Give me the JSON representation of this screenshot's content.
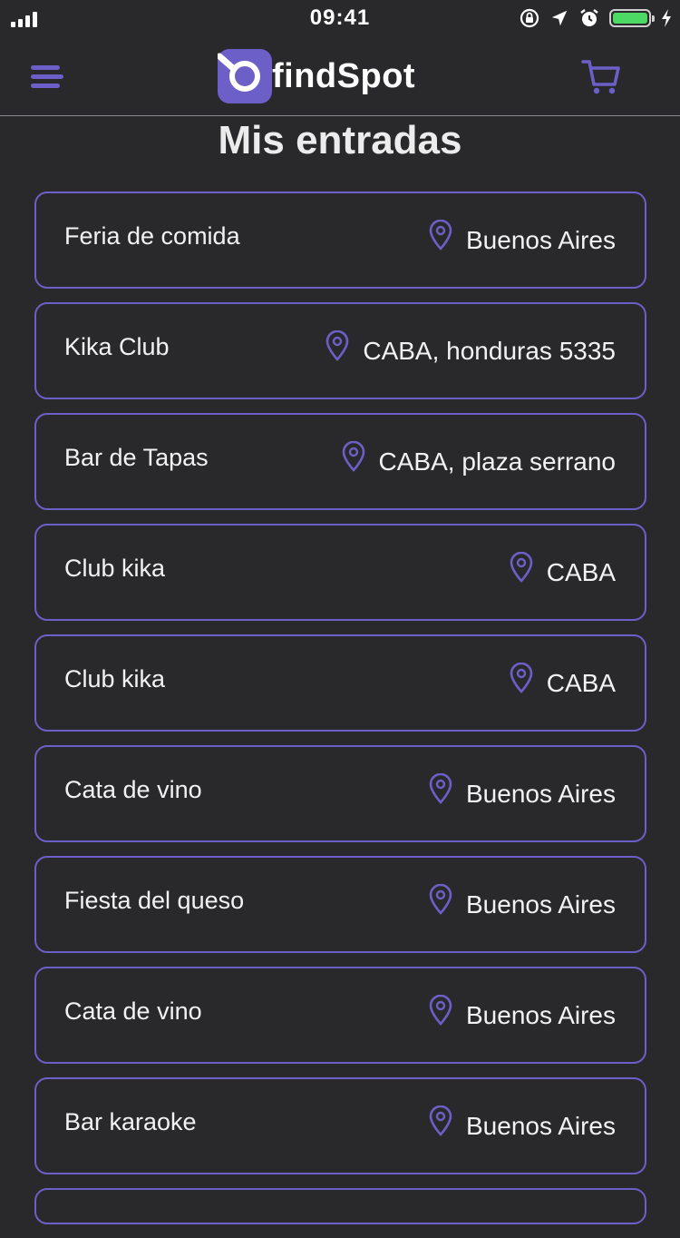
{
  "status_bar": {
    "time": "09:41"
  },
  "header": {
    "logo_text": "findSpot",
    "menu_icon": "hamburger-menu-icon",
    "cart_icon": "shopping-cart-icon"
  },
  "page": {
    "title": "Mis entradas"
  },
  "colors": {
    "accent": "#6d5fc8",
    "background": "#29292b",
    "battery": "#4cd964"
  },
  "tickets": [
    {
      "name": "Feria de comida",
      "location": "Buenos Aires"
    },
    {
      "name": "Kika Club",
      "location": "CABA, honduras 5335"
    },
    {
      "name": "Bar de Tapas",
      "location": "CABA, plaza serrano"
    },
    {
      "name": "Club kika",
      "location": "CABA"
    },
    {
      "name": "Club kika",
      "location": "CABA"
    },
    {
      "name": "Cata de vino",
      "location": "Buenos Aires"
    },
    {
      "name": "Fiesta del queso",
      "location": "Buenos Aires"
    },
    {
      "name": "Cata de vino",
      "location": "Buenos Aires"
    },
    {
      "name": "Bar karaoke",
      "location": "Buenos Aires"
    }
  ]
}
